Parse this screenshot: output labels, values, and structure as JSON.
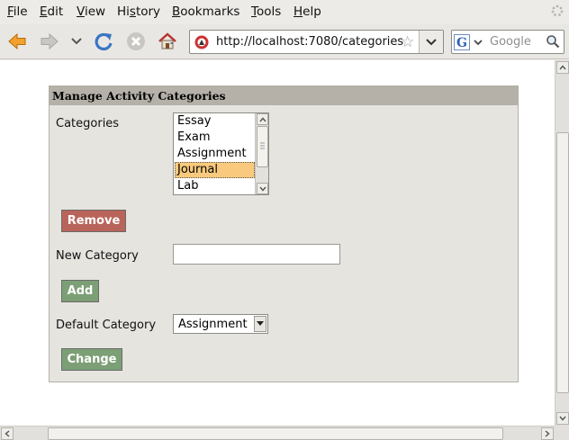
{
  "menubar": {
    "items": [
      {
        "pre": "",
        "u": "F",
        "post": "ile"
      },
      {
        "pre": "",
        "u": "E",
        "post": "dit"
      },
      {
        "pre": "",
        "u": "V",
        "post": "iew"
      },
      {
        "pre": "Hi",
        "u": "s",
        "post": "tory"
      },
      {
        "pre": "",
        "u": "B",
        "post": "ookmarks"
      },
      {
        "pre": "",
        "u": "T",
        "post": "ools"
      },
      {
        "pre": "",
        "u": "H",
        "post": "elp"
      }
    ]
  },
  "navbar": {
    "icons": [
      "back-arrow-icon",
      "forward-arrow-icon",
      "history-dropdown-icon",
      "reload-icon",
      "stop-icon",
      "home-icon"
    ],
    "url": "http://localhost:7080/categories",
    "search_placeholder": "Google"
  },
  "panel": {
    "title": "Manage Activity Categories",
    "categories_label": "Categories",
    "categories": [
      "Essay",
      "Exam",
      "Assignment",
      "Journal",
      "Lab"
    ],
    "selected_category": "Journal",
    "remove_label": "Remove",
    "new_category_label": "New Category",
    "new_category_value": "",
    "add_label": "Add",
    "default_category_label": "Default Category",
    "default_category_value": "Assignment",
    "change_label": "Change"
  },
  "colors": {
    "remove_button": "#b9645a",
    "add_button": "#7c9f75",
    "selection": "#f9ca7d",
    "panel_header": "#b5b1a8",
    "panel_bg": "#e6e4df"
  }
}
